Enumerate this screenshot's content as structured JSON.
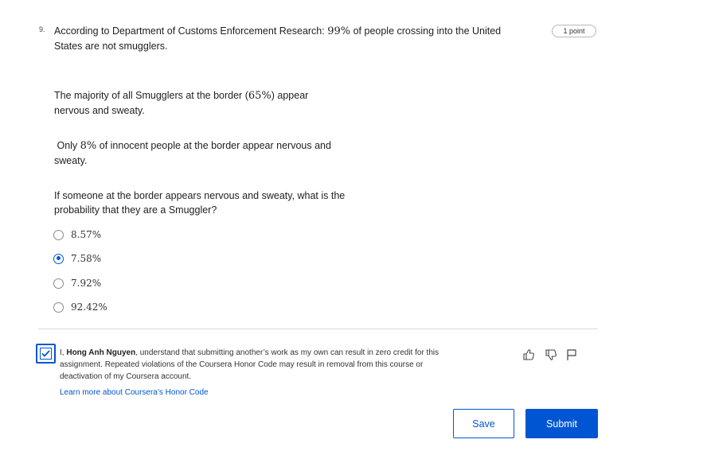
{
  "question": {
    "number": "9.",
    "points": "1 point",
    "line1_pre": "According to Department of Customs Enforcement Research: ",
    "line1_math": "99%",
    "line1_post": " of people crossing into the United States are not smugglers.",
    "p2_pre": "The majority of all Smugglers at the border (",
    "p2_math": "65%",
    "p2_post": ") appear nervous and sweaty.",
    "p3_pre": " Only ",
    "p3_math": "8%",
    "p3_post": " of innocent people at the border appear nervous and sweaty.",
    "p4": "If someone at the border appears nervous and sweaty, what is the probability that they are a Smuggler?"
  },
  "options": [
    {
      "label": "8.57%",
      "selected": false
    },
    {
      "label": "7.58%",
      "selected": true
    },
    {
      "label": "7.92%",
      "selected": false
    },
    {
      "label": "92.42%",
      "selected": false
    }
  ],
  "honor": {
    "checked": true,
    "prefix": "I, ",
    "name": "Hong Anh Nguyen",
    "text": ", understand that submitting another’s work as my own can result in zero credit for this assignment. Repeated violations of the Coursera Honor Code may result in removal from this course or deactivation of my Coursera account.",
    "link": "Learn more about Coursera’s Honor Code"
  },
  "actions": {
    "like_icon": "thumbs-up-icon",
    "dislike_icon": "thumbs-down-icon",
    "flag_icon": "flag-icon",
    "save_label": "Save",
    "submit_label": "Submit"
  },
  "colors": {
    "accent": "#0056d2"
  }
}
